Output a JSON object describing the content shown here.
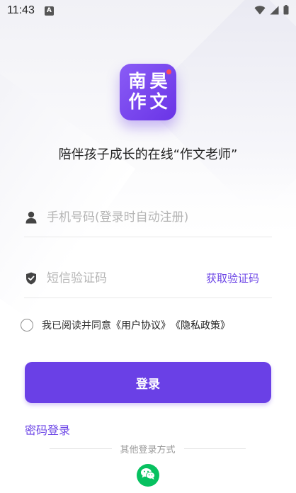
{
  "status_bar": {
    "time": "11:43",
    "notification_badge": "A",
    "icons": [
      "wifi-icon",
      "signal-icon",
      "battery-icon"
    ]
  },
  "logo": {
    "chars": [
      "南",
      "昊",
      "作",
      "文"
    ],
    "brand_color": "#6a40e6"
  },
  "slogan": "陪伴孩子成长的在线“作文老师”",
  "phone_field": {
    "icon": "user-icon",
    "placeholder": "手机号码(登录时自动注册)",
    "value": ""
  },
  "code_field": {
    "icon": "shield-icon",
    "placeholder": "短信验证码",
    "value": "",
    "get_code_label": "获取验证码"
  },
  "agreement": {
    "checked": false,
    "prefix": "我已阅读并同意",
    "user_agreement": "《用户协议》",
    "privacy_policy": "《隐私政策》"
  },
  "login_button": "登录",
  "password_login": "密码登录",
  "other_login": {
    "label": "其他登录方式",
    "methods": [
      "wechat-icon"
    ]
  },
  "colors": {
    "accent": "#6a40e6",
    "link": "#6b44e6",
    "wechat": "#07c160"
  }
}
